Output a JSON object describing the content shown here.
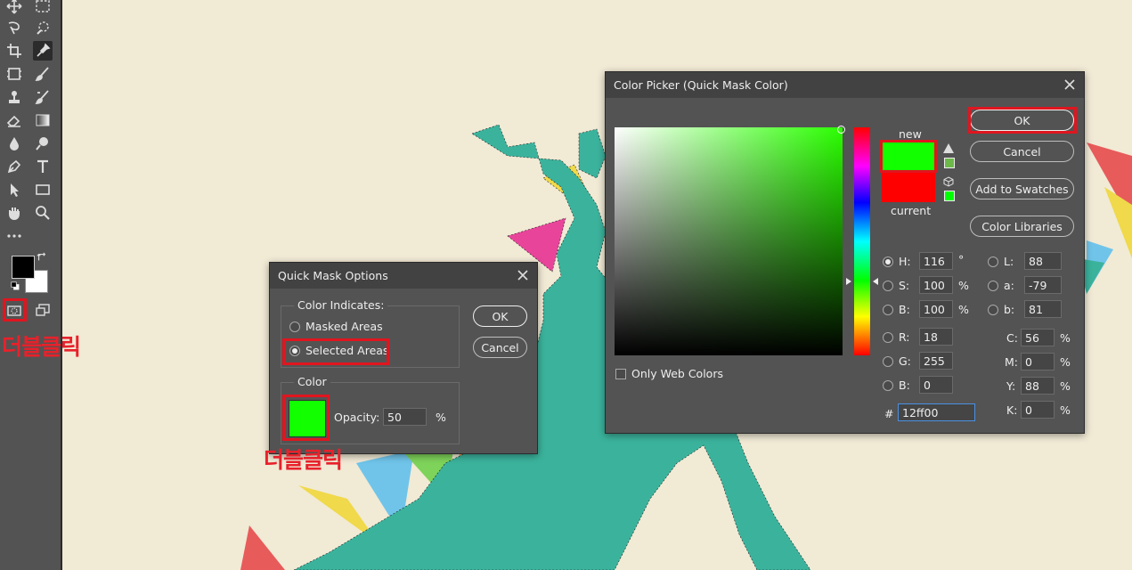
{
  "annotations": {
    "toolbar_note": "더블클릭",
    "color_note": "더블클릭"
  },
  "quick_mask": {
    "title": "Quick Mask Options",
    "color_indicates_legend": "Color Indicates:",
    "option_masked": "Masked Areas",
    "option_selected": "Selected Areas",
    "selected_option": "Selected Areas",
    "color_legend": "Color",
    "swatch_color": "#12ff00",
    "opacity_label": "Opacity:",
    "opacity_value": "50",
    "opacity_unit": "%",
    "ok_label": "OK",
    "cancel_label": "Cancel"
  },
  "color_picker": {
    "title": "Color Picker (Quick Mask Color)",
    "new_label": "new",
    "current_label": "current",
    "new_color": "#12ff00",
    "current_color": "#ff0000",
    "ok_label": "OK",
    "cancel_label": "Cancel",
    "add_swatches_label": "Add to Swatches",
    "color_libraries_label": "Color Libraries",
    "only_web_label": "Only Web Colors",
    "hsb": {
      "h_label": "H:",
      "h_value": "116",
      "h_unit": "°",
      "s_label": "S:",
      "s_value": "100",
      "s_unit": "%",
      "b_label": "B:",
      "b_value": "100",
      "b_unit": "%"
    },
    "rgb": {
      "r_label": "R:",
      "r_value": "18",
      "g_label": "G:",
      "g_value": "255",
      "b_label": "B:",
      "b_value": "0"
    },
    "lab": {
      "l_label": "L:",
      "l_value": "88",
      "a_label": "a:",
      "a_value": "-79",
      "b_label": "b:",
      "b_value": "81"
    },
    "cmyk": {
      "c_label": "C:",
      "c_value": "56",
      "c_unit": "%",
      "m_label": "M:",
      "m_value": "0",
      "m_unit": "%",
      "y_label": "Y:",
      "y_value": "88",
      "y_unit": "%",
      "k_label": "K:",
      "k_value": "0",
      "k_unit": "%"
    },
    "hex_label": "#",
    "hex_value": "12ff00"
  },
  "colors": {
    "ui_panel": "#535353",
    "title_bar": "#424242",
    "highlight_red": "#e0151f",
    "canvas_bg": "#f1ead5",
    "dino_teal": "#3bb39c"
  }
}
